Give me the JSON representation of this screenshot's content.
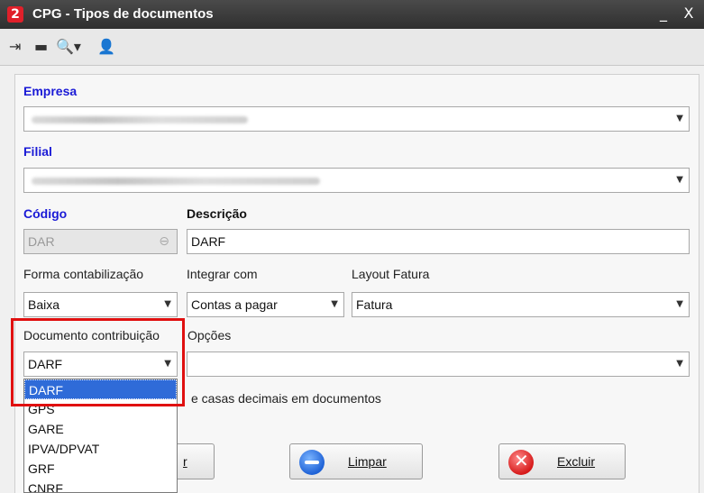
{
  "window": {
    "title": "CPG - Tipos de documentos",
    "minimize": "_",
    "close": "X"
  },
  "toolbar": {
    "icons": [
      "exit-icon",
      "card-icon",
      "search-icon",
      "user-icon"
    ]
  },
  "form": {
    "empresa": {
      "label": "Empresa",
      "value": ""
    },
    "filial": {
      "label": "Filial",
      "value": ""
    },
    "codigo": {
      "label": "Código",
      "value": "DAR"
    },
    "descricao": {
      "label": "Descrição",
      "value": "DARF"
    },
    "forma_contabilizacao": {
      "label": "Forma contabilização",
      "value": "Baixa"
    },
    "integrar_com": {
      "label": "Integrar com",
      "value": "Contas a pagar"
    },
    "layout_fatura": {
      "label": "Layout Fatura",
      "value": "Fatura"
    },
    "documento_contribuicao": {
      "label": "Documento contribuição",
      "value": "DARF"
    },
    "opcoes": {
      "label": "Opções",
      "value": ""
    },
    "checkbox_label_partial": "e casas decimais em documentos"
  },
  "dropdown": {
    "options": [
      "DARF",
      "GPS",
      "GARE",
      "IPVA/DPVAT",
      "GRF",
      "CNRF"
    ],
    "selected": "DARF"
  },
  "buttons": {
    "hidden_partial": "r",
    "limpar": "Limpar",
    "excluir": "Excluir"
  },
  "colors": {
    "label_blue": "#1a1ad6",
    "selection": "#2f6bd8",
    "highlight": "#e01010"
  }
}
